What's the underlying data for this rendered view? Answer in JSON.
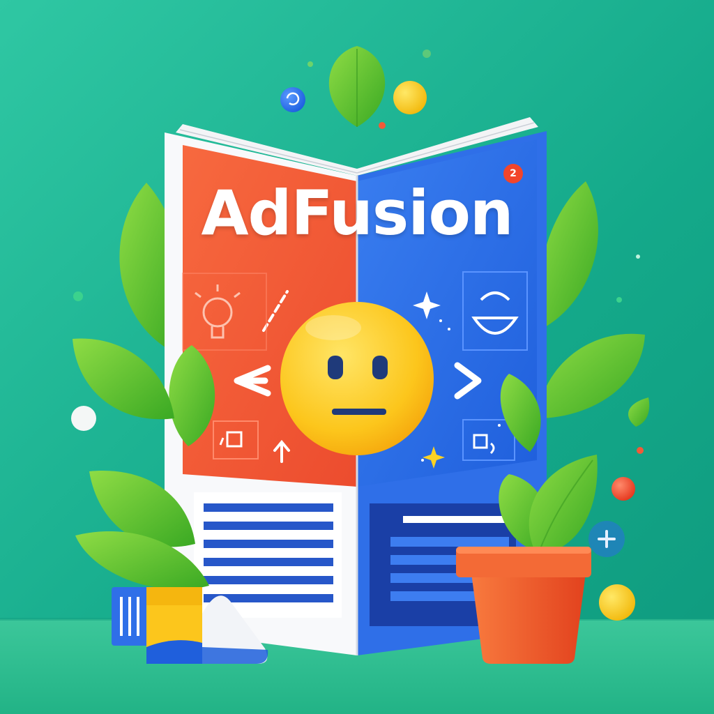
{
  "brand": {
    "name": "AdFusion"
  },
  "badge": {
    "count": "2"
  },
  "colors": {
    "background": "#1fb38f",
    "page_left": "#f25a38",
    "page_right": "#2f6fe8",
    "emoji": "#fcc61c",
    "leaf": "#5bc431",
    "pot": "#f0552c"
  },
  "icons": [
    "smiley-face-icon",
    "arrow-left-icon",
    "arrow-right-icon",
    "lightbulb-icon",
    "sparkle-icon",
    "plus-icon"
  ]
}
